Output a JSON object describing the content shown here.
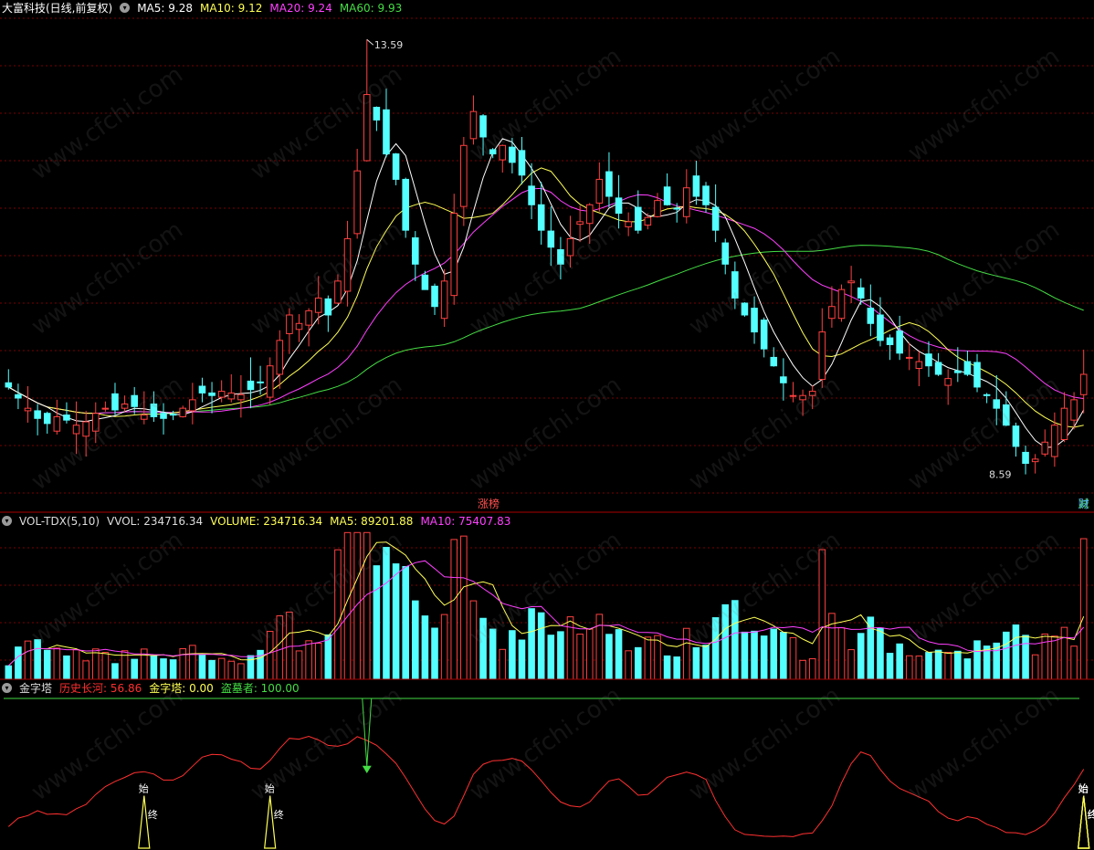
{
  "main": {
    "title": "大富科技(日线,前复权)",
    "indicators": [
      {
        "label": "MA5: 9.28",
        "color": "#ffffff"
      },
      {
        "label": "MA10: 9.12",
        "color": "#ffff55"
      },
      {
        "label": "MA20: 9.24",
        "color": "#ff40ff"
      },
      {
        "label": "MA60: 9.93",
        "color": "#44dd44"
      }
    ],
    "max_label": "13.59",
    "min_label": "8.59",
    "markers": [
      {
        "text": "涨榜",
        "color": "#ff5050",
        "bar": 49
      },
      {
        "text": "减",
        "color": "#44dd44",
        "bar": 158
      },
      {
        "text": "财",
        "color": "#55aaff",
        "bar": 185
      }
    ]
  },
  "volume": {
    "title": "VOL-TDX(5,10)",
    "indicators": [
      {
        "label": "VVOL: 234716.34",
        "color": "#dddddd"
      },
      {
        "label": "VOLUME: 234716.34",
        "color": "#ffff55"
      },
      {
        "label": "MA5: 89201.88",
        "color": "#ffff55"
      },
      {
        "label": "MA10: 75407.83",
        "color": "#ff40ff"
      }
    ]
  },
  "indicator": {
    "title": "金字塔",
    "indicators": [
      {
        "label": "历史长河: 56.86",
        "color": "#ff3030"
      },
      {
        "label": "金字塔: 0.00",
        "color": "#ffff55"
      },
      {
        "label": "盗墓者: 100.00",
        "color": "#44dd44"
      }
    ],
    "signal_start": "始",
    "signal_end": "终"
  },
  "watermark": "www.cfchi.com",
  "colors": {
    "up": "#ff4040",
    "down": "#54ffff",
    "ma5": "#ffffff",
    "ma10": "#ffff55",
    "ma20": "#ff40ff",
    "ma60": "#44dd44",
    "grid": "#7a0000"
  },
  "chart_data": {
    "type": "candlestick",
    "price_range": [
      8.3,
      13.9
    ],
    "candles": [],
    "ohlc_anchor_closes": [
      9.55,
      9.42,
      9.3,
      9.18,
      9.12,
      9.2,
      9.16,
      9.1,
      9.14,
      9.24,
      9.3,
      9.28,
      9.35,
      9.32,
      9.22,
      9.2,
      9.18,
      9.22,
      9.3,
      9.4,
      9.48,
      9.45,
      9.5,
      9.48,
      9.46,
      9.52,
      9.6,
      9.8,
      10.1,
      10.4,
      10.3,
      10.45,
      10.6,
      10.4,
      10.8,
      11.3,
      12.1,
      13.0,
      12.7,
      12.3,
      12.0,
      11.4,
      11.0,
      10.7,
      10.5,
      10.8,
      11.6,
      12.4,
      12.8,
      12.5,
      12.3,
      12.4,
      12.2,
      12.05,
      11.7,
      11.4,
      11.2,
      11.0,
      11.3,
      11.5,
      11.7,
      12.0,
      11.8,
      11.6,
      11.5,
      11.4,
      11.55,
      11.75,
      11.7,
      11.65,
      11.9,
      11.8,
      11.7,
      11.4,
      11.0,
      10.6,
      10.4,
      10.2,
      10.0,
      9.8,
      9.6,
      9.45,
      9.45,
      9.5,
      10.2,
      10.5,
      10.7,
      10.8,
      10.6,
      10.3,
      10.1,
      10.05,
      9.95,
      9.9,
      9.85,
      9.8,
      9.7,
      9.65,
      9.72,
      9.7,
      9.55,
      9.45,
      9.3,
      9.1,
      8.85,
      8.65,
      8.7,
      8.9,
      9.1,
      9.3,
      9.4,
      9.7
    ],
    "volume_range": [
      0,
      250000
    ],
    "indicator_range": [
      0,
      100
    ]
  }
}
